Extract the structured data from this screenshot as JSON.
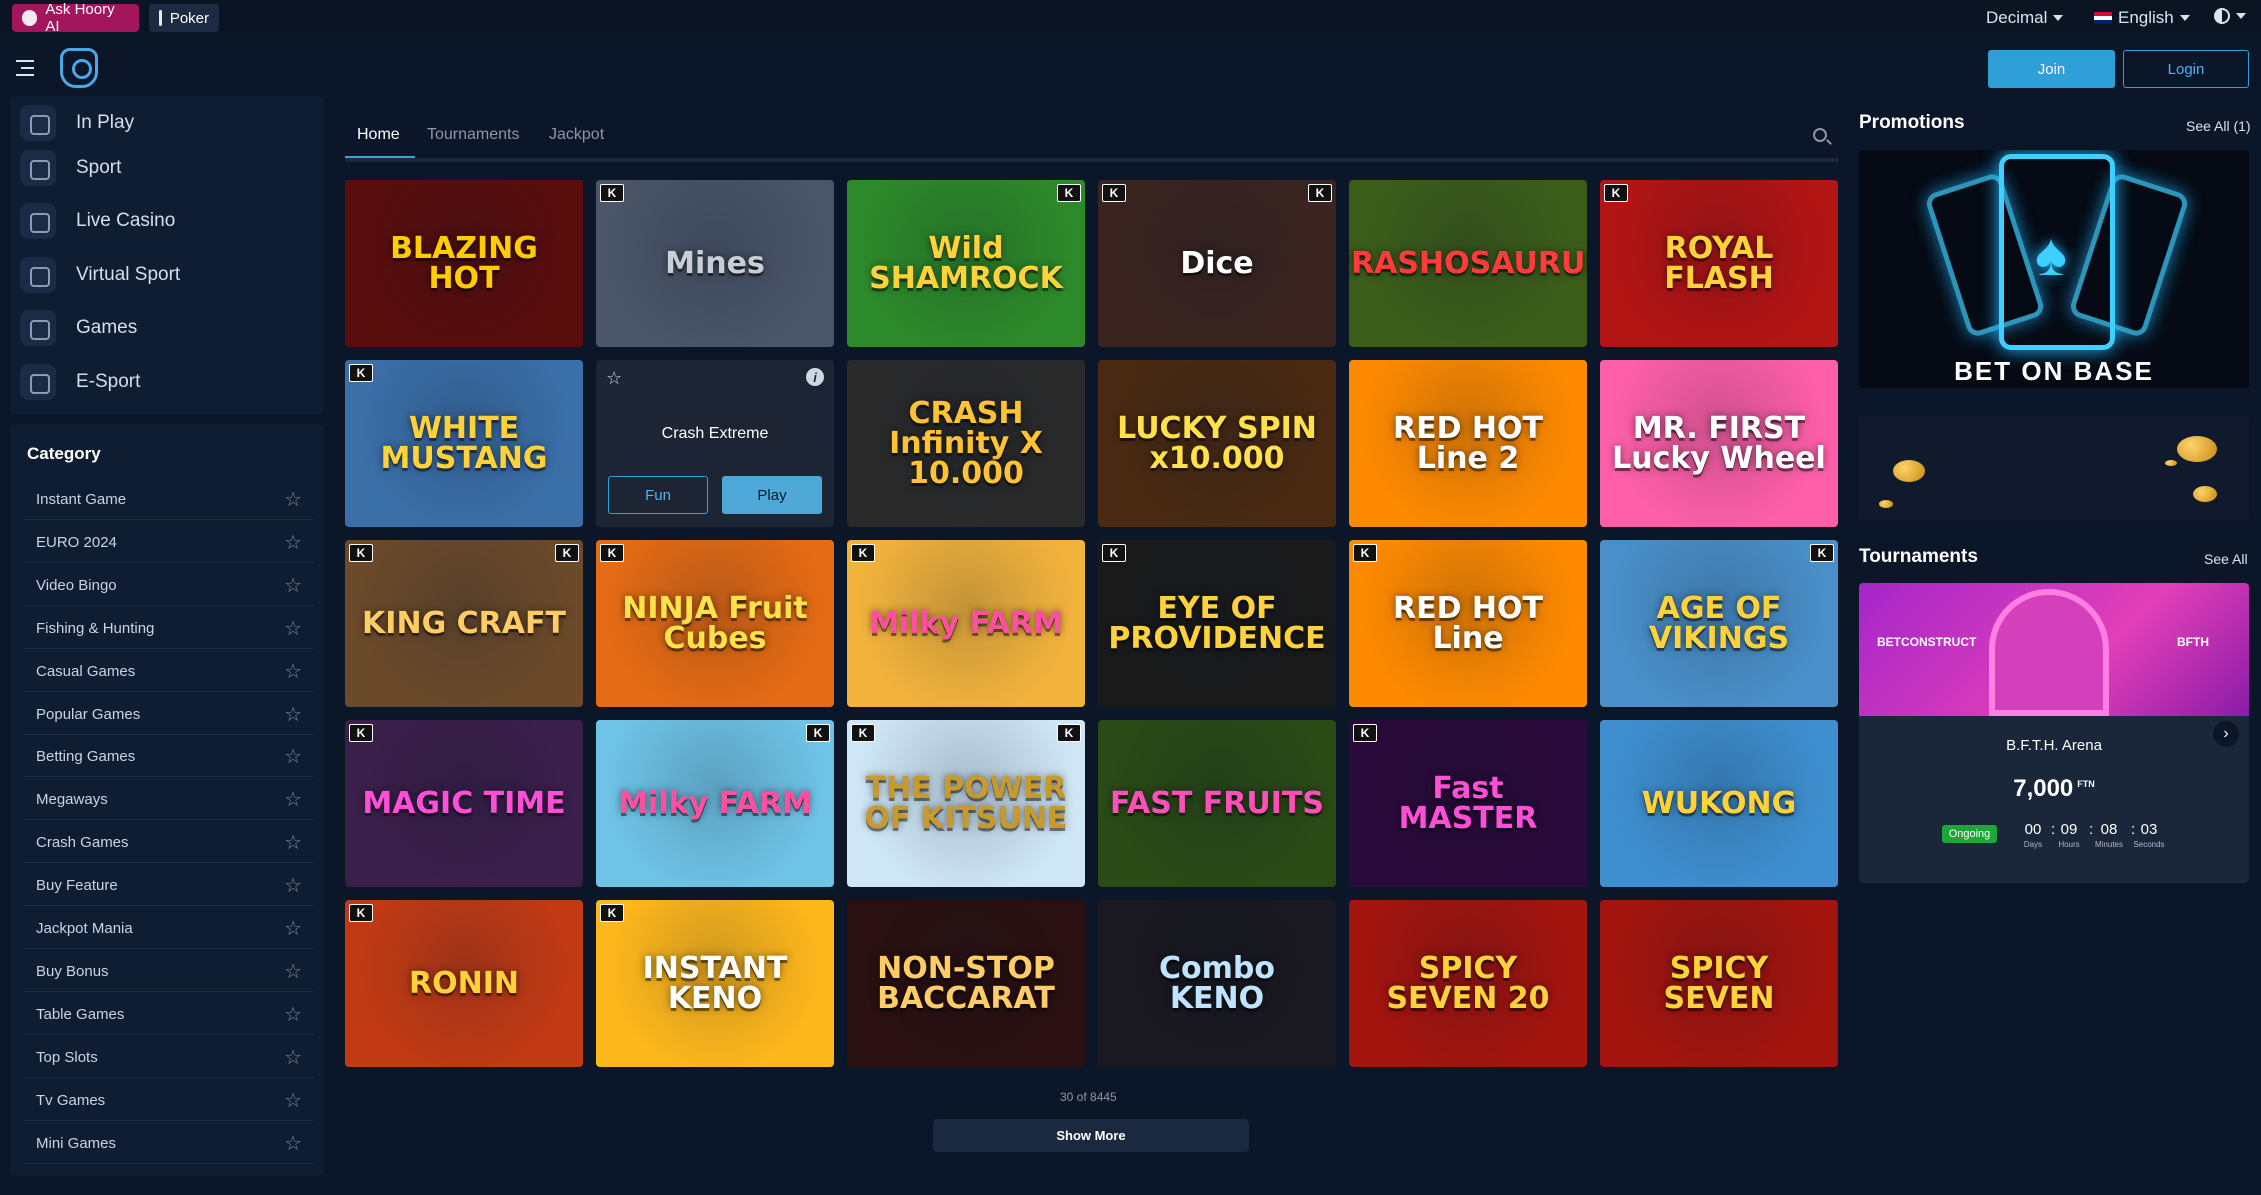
{
  "topbar": {
    "ai_label": "Ask Hoory AI",
    "poker_label": "Poker",
    "odds_format": "Decimal",
    "language": "English"
  },
  "header": {
    "join": "Join",
    "login": "Login"
  },
  "nav": [
    {
      "label": "In Play",
      "icon": "live-icon"
    },
    {
      "label": "Sport",
      "icon": "sport-icon"
    },
    {
      "label": "Live Casino",
      "icon": "live-casino-icon"
    },
    {
      "label": "Virtual Sport",
      "icon": "virtual-sport-icon"
    },
    {
      "label": "Games",
      "icon": "games-icon"
    },
    {
      "label": "E-Sport",
      "icon": "gamepad-icon"
    }
  ],
  "category": {
    "title": "Category",
    "items": [
      "Instant Game",
      "EURO 2024",
      "Video Bingo",
      "Fishing & Hunting",
      "Casual Games",
      "Popular Games",
      "Betting Games",
      "Megaways",
      "Crash Games",
      "Buy Feature",
      "Jackpot Mania",
      "Buy Bonus",
      "Table Games",
      "Top Slots",
      "Tv Games",
      "Mini Games"
    ]
  },
  "tabs": [
    "Home",
    "Tournaments",
    "Jackpot"
  ],
  "games": [
    {
      "title": "BLAZING HOT",
      "bg": "#5a0d0d",
      "fg": "#ffcc00"
    },
    {
      "title": "Mines",
      "bg": "#4a5568",
      "fg": "#c9ced6"
    },
    {
      "title": "Wild SHAMROCK",
      "bg": "#2d8a2a",
      "fg": "#ffd23a"
    },
    {
      "title": "Dice",
      "bg": "#3a2420",
      "fg": "#ffffff"
    },
    {
      "title": "CRASHOSAURUS",
      "bg": "#3c5d1a",
      "fg": "#ff3b3b"
    },
    {
      "title": "ROYAL FLASH",
      "bg": "#b31414",
      "fg": "#ffd23a"
    },
    {
      "title": "WHITE MUSTANG",
      "bg": "#3b6fa8",
      "fg": "#ffd23a"
    },
    {
      "title": "Crash Extreme",
      "hover": true,
      "fun": "Fun",
      "play": "Play"
    },
    {
      "title": "CRASH Infinity X 10.000",
      "bg": "#2a2a2a",
      "fg": "#ffc233"
    },
    {
      "title": "LUCKY SPIN x10.000",
      "bg": "#4a2a12",
      "fg": "#ffe14a"
    },
    {
      "title": "RED HOT Line 2",
      "bg": "#ff8a00",
      "fg": "#ffffff"
    },
    {
      "title": "MR. FIRST Lucky Wheel",
      "bg": "#ff5fa8",
      "fg": "#ffffff"
    },
    {
      "title": "KING CRAFT",
      "bg": "#6b4a2a",
      "fg": "#ffcc66"
    },
    {
      "title": "NINJA Fruit Cubes",
      "bg": "#e56b14",
      "fg": "#ffe14a"
    },
    {
      "title": "Milky FARM",
      "bg": "#f2b33c",
      "fg": "#ff4fa0"
    },
    {
      "title": "EYE OF PROVIDENCE",
      "bg": "#1a1a1a",
      "fg": "#ffd23a"
    },
    {
      "title": "RED HOT Line",
      "bg": "#ff8a00",
      "fg": "#ffffff"
    },
    {
      "title": "AGE OF VIKINGS",
      "bg": "#4a8fc9",
      "fg": "#ffd23a"
    },
    {
      "title": "MAGIC TIME",
      "bg": "#3a1f4a",
      "fg": "#ff4fd8"
    },
    {
      "title": "Milky FARM",
      "bg": "#6fc3e6",
      "fg": "#ff4fa0"
    },
    {
      "title": "THE POWER OF KITSUNE",
      "bg": "#cfe6f5",
      "fg": "#c89a2a"
    },
    {
      "title": "FAST FRUITS",
      "bg": "#2a4a16",
      "fg": "#ff4fb8"
    },
    {
      "title": "Fast MASTER",
      "bg": "#2a0a3a",
      "fg": "#ff4fd8"
    },
    {
      "title": "WUKONG",
      "bg": "#3f8fd0",
      "fg": "#ffd23a"
    },
    {
      "title": "RONIN",
      "bg": "#c23a14",
      "fg": "#ffd23a"
    },
    {
      "title": "INSTANT KENO",
      "bg": "#ffb81c",
      "fg": "#ffffff"
    },
    {
      "title": "NON-STOP BACCARAT",
      "bg": "#2a1010",
      "fg": "#ffcc66"
    },
    {
      "title": "Combo KENO",
      "bg": "#1a1820",
      "fg": "#bfe4ff"
    },
    {
      "title": "SPICY SEVEN 20",
      "bg": "#a3140e",
      "fg": "#ffd23a"
    },
    {
      "title": "SPICY SEVEN",
      "bg": "#a3140e",
      "fg": "#ffd23a"
    }
  ],
  "pagination": {
    "count_text": "30 of 8445",
    "show_more": "Show More"
  },
  "promotions": {
    "title": "Promotions",
    "see_all": "See All (1)",
    "banner_text": "BET ON BASE"
  },
  "tournaments": {
    "title": "Tournaments",
    "see_all": "See All",
    "card": {
      "brand_left": "BETCONSTRUCT",
      "brand_right": "BFTH",
      "name": "B.F.T.H. Arena",
      "prize": "7,000",
      "currency": "FTN",
      "status": "Ongoing",
      "countdown": [
        {
          "value": "00",
          "unit": "Days"
        },
        {
          "value": "09",
          "unit": "Hours"
        },
        {
          "value": "08",
          "unit": "Minutes"
        },
        {
          "value": "03",
          "unit": "Seconds"
        }
      ]
    }
  }
}
